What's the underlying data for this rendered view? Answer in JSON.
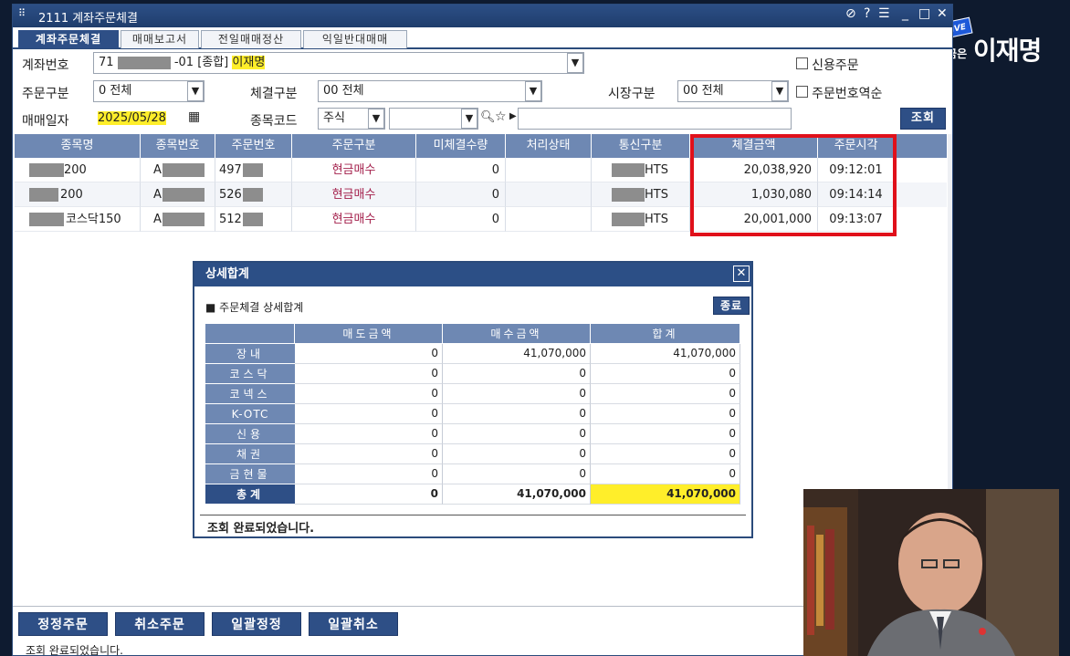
{
  "window": {
    "title": "2111 계좌주문체결",
    "icon": "grid-menu-icon",
    "buttons": [
      "link-icon",
      "?",
      "menu-icon",
      "_",
      "□",
      "X"
    ]
  },
  "tabs": [
    "계좌주문체결",
    "매매보고서",
    "전일매매정산",
    "익일반대매매"
  ],
  "form": {
    "account_label": "계좌번호",
    "account_prefix": "71",
    "account_suffix": "-01 [종합]",
    "account_name": "이재명",
    "credit_order": "신용주문",
    "order_type_label": "주문구분",
    "order_type_value": "0 전체",
    "exec_type_label": "체결구분",
    "exec_type_value": "00 전체",
    "market_label": "시장구분",
    "market_value": "00 전체",
    "reverse_order": "주문번호역순",
    "date_label": "매매일자",
    "date_value": "2025/05/28",
    "stock_code_label": "종목코드",
    "stock_code_type": "주식",
    "query_button": "조회"
  },
  "grid": {
    "headers": [
      "종목명",
      "종목번호",
      "주문번호",
      "주문구분",
      "미체결수량",
      "처리상태",
      "통신구분",
      "체결금액",
      "주문시각"
    ],
    "rows": [
      {
        "name": "200",
        "code": "A",
        "order_no": "497",
        "type": "현금매수",
        "unfilled": "0",
        "status": "",
        "comm": "HTS",
        "amount": "20,038,920",
        "time": "09:12:01"
      },
      {
        "name": "200",
        "code": "A",
        "order_no": "526",
        "type": "현금매수",
        "unfilled": "0",
        "status": "",
        "comm": "HTS",
        "amount": "1,030,080",
        "time": "09:14:14"
      },
      {
        "name": "코스닥150",
        "code": "A",
        "order_no": "512",
        "type": "현금매수",
        "unfilled": "0",
        "status": "",
        "comm": "HTS",
        "amount": "20,001,000",
        "time": "09:13:07"
      }
    ]
  },
  "modal": {
    "title": "상세합계",
    "subtitle": "■ 주문체결 상세합계",
    "close_button": "종료",
    "headers": [
      "매도금액",
      "매수금액",
      "합계"
    ],
    "rows": [
      {
        "label": "장내",
        "sell": "0",
        "buy": "41,070,000",
        "total": "41,070,000"
      },
      {
        "label": "코스닥",
        "sell": "0",
        "buy": "0",
        "total": "0"
      },
      {
        "label": "코넥스",
        "sell": "0",
        "buy": "0",
        "total": "0"
      },
      {
        "label": "K-OTC",
        "sell": "0",
        "buy": "0",
        "total": "0"
      },
      {
        "label": "신용",
        "sell": "0",
        "buy": "0",
        "total": "0"
      },
      {
        "label": "채권",
        "sell": "0",
        "buy": "0",
        "total": "0"
      },
      {
        "label": "금현물",
        "sell": "0",
        "buy": "0",
        "total": "0"
      }
    ],
    "total_row": {
      "label": "총계",
      "sell": "0",
      "buy": "41,070,000",
      "total": "41,070,000"
    },
    "status": "조회 완료되었습니다."
  },
  "bottom_buttons": [
    "정정주문",
    "취소주문",
    "일괄정정",
    "일괄취소"
  ],
  "status_bar": "조회 완료되었습니다.",
  "overlay": {
    "live_badge": "LIVE",
    "brand_small": "지금은",
    "brand_name": "이재명"
  },
  "colors": {
    "header": "#6e88b3",
    "title": "#2c4f86",
    "highlight": "#ffee2a",
    "red_box": "#e0101a"
  }
}
